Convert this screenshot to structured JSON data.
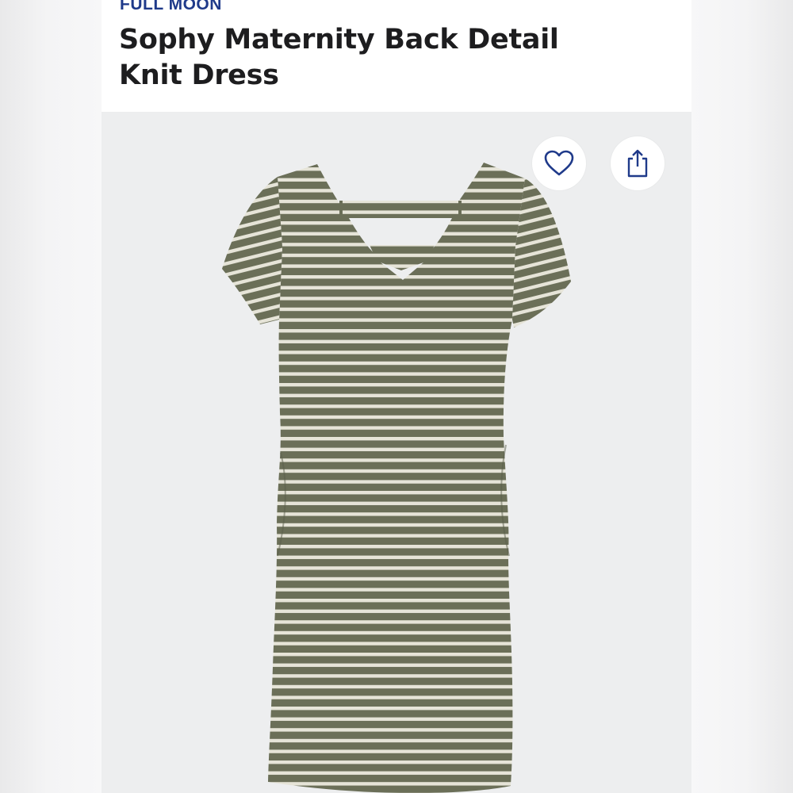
{
  "product": {
    "brand": "FULL MOON",
    "title": "Sophy Maternity Back Detail Knit Dress"
  },
  "actions": {
    "favorite_icon": "heart-outline-icon",
    "share_icon": "share-up-arrow-icon"
  },
  "colors": {
    "brand_text": "#1f3a8a",
    "title_text": "#1d1d1f",
    "image_background": "#edeeef",
    "dress_stripe_dark": "#6b6f58",
    "dress_stripe_light": "#e6e4d8",
    "icon_color": "#1f3a8a"
  }
}
